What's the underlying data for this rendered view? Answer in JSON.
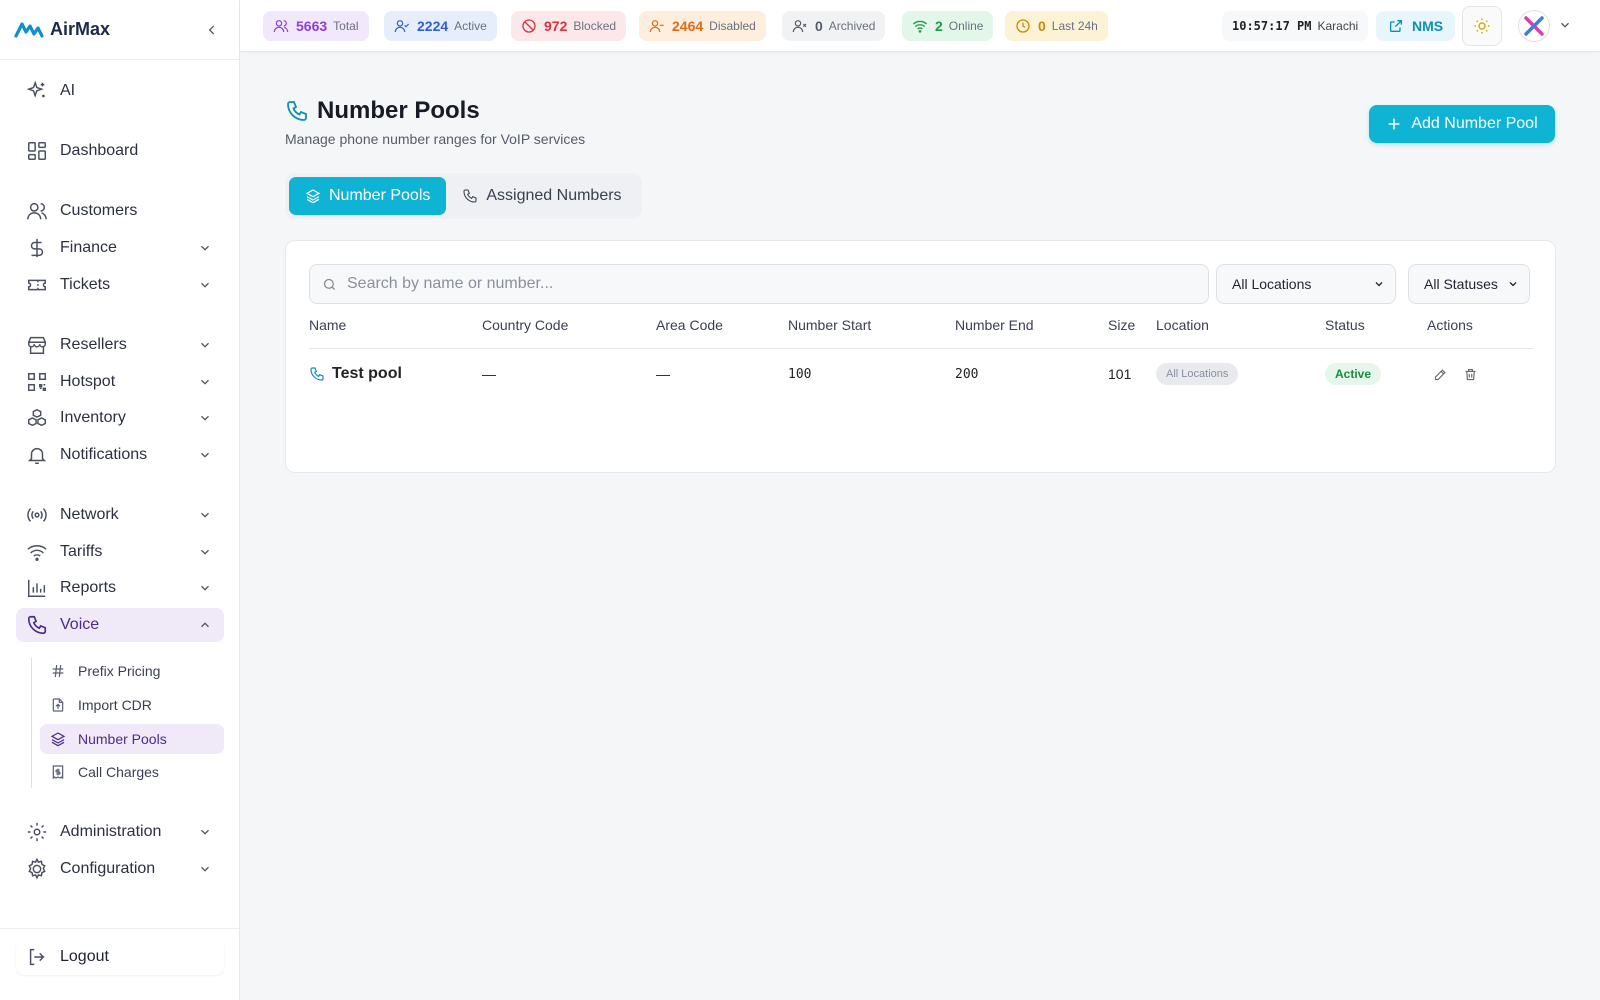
{
  "brand": {
    "name": "AirMax",
    "accent": "#0fb3d4",
    "nav_active_bg": "#efe9f8"
  },
  "sidebar": {
    "items": [
      {
        "label": "AI",
        "icon": "sparkles-icon"
      },
      {
        "label": "Dashboard",
        "icon": "dashboard-icon"
      },
      {
        "label": "Customers",
        "icon": "users-icon"
      },
      {
        "label": "Finance",
        "icon": "dollar-icon"
      },
      {
        "label": "Tickets",
        "icon": "ticket-icon"
      },
      {
        "label": "Resellers",
        "icon": "store-icon"
      },
      {
        "label": "Hotspot",
        "icon": "qr-icon"
      },
      {
        "label": "Inventory",
        "icon": "boxes-icon"
      },
      {
        "label": "Notifications",
        "icon": "bell-icon"
      },
      {
        "label": "Network",
        "icon": "radio-icon"
      },
      {
        "label": "Tariffs",
        "icon": "wifi-icon"
      },
      {
        "label": "Reports",
        "icon": "bar-chart-icon"
      },
      {
        "label": "Voice",
        "icon": "phone-icon"
      },
      {
        "label": "Administration",
        "icon": "gear-icon"
      },
      {
        "label": "Configuration",
        "icon": "cog-icon"
      }
    ],
    "voice_sub": [
      {
        "label": "Prefix Pricing",
        "icon": "hash-icon"
      },
      {
        "label": "Import CDR",
        "icon": "file-upload-icon"
      },
      {
        "label": "Number Pools",
        "icon": "layers-icon"
      },
      {
        "label": "Call Charges",
        "icon": "receipt-icon"
      }
    ],
    "logout": "Logout"
  },
  "topbar": {
    "stats": [
      {
        "value": "5663",
        "label": "Total",
        "color": "#8e3fd6",
        "bg": "#f1e8fb"
      },
      {
        "value": "2224",
        "label": "Active",
        "color": "#2f5fd0",
        "bg": "#e6eefc"
      },
      {
        "value": "972",
        "label": "Blocked",
        "color": "#d6333f",
        "bg": "#fce8ea"
      },
      {
        "value": "2464",
        "label": "Disabled",
        "color": "#e06b18",
        "bg": "#fdeedd"
      },
      {
        "value": "0",
        "label": "Archived",
        "color": "#555b68",
        "bg": "#f1f2f4"
      },
      {
        "value": "2",
        "label": "Online",
        "color": "#1c9a4a",
        "bg": "#e2f6e9"
      },
      {
        "value": "0",
        "label": "Last 24h",
        "color": "#c98a06",
        "bg": "#fcf3d6"
      }
    ],
    "clock": {
      "time": "10:57:17 PM",
      "zone": "Karachi"
    },
    "nms": "NMS"
  },
  "page": {
    "title": "Number Pools",
    "subtitle": "Manage phone number ranges for VoIP services",
    "add_button": "Add Number Pool",
    "tabs": [
      "Number Pools",
      "Assigned Numbers"
    ],
    "search_placeholder": "Search by name or number...",
    "filters": {
      "location": "All Locations",
      "status": "All Statuses"
    },
    "columns": [
      "Name",
      "Country Code",
      "Area Code",
      "Number Start",
      "Number End",
      "Size",
      "Location",
      "Status",
      "Actions"
    ],
    "rows": [
      {
        "name": "Test pool",
        "country_code": "—",
        "area_code": "—",
        "start": "100",
        "end": "200",
        "size": "101",
        "location": "All Locations",
        "status": "Active"
      }
    ]
  }
}
